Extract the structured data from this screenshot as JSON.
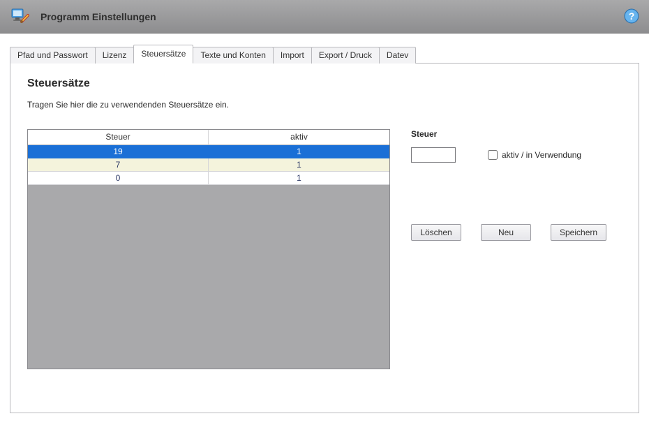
{
  "banner": {
    "title": "Programm Einstellungen"
  },
  "tabs": [
    {
      "label": "Pfad und Passwort",
      "active": false
    },
    {
      "label": "Lizenz",
      "active": false
    },
    {
      "label": "Steuersätze",
      "active": true
    },
    {
      "label": "Texte und Konten",
      "active": false
    },
    {
      "label": "Import",
      "active": false
    },
    {
      "label": "Export / Druck",
      "active": false
    },
    {
      "label": "Datev",
      "active": false
    }
  ],
  "panel": {
    "heading": "Steuersätze",
    "description": "Tragen Sie hier die zu verwendenden Steuersätze ein."
  },
  "grid": {
    "columns": [
      "Steuer",
      "aktiv"
    ],
    "rows": [
      {
        "steuer": "19",
        "aktiv": "1",
        "style": "sel"
      },
      {
        "steuer": "7",
        "aktiv": "1",
        "style": "alt"
      },
      {
        "steuer": "0",
        "aktiv": "1",
        "style": "norm"
      }
    ]
  },
  "side": {
    "label": "Steuer",
    "input_value": "",
    "checkbox_label": "aktiv / in Verwendung",
    "checkbox_checked": false
  },
  "buttons": {
    "delete": "Löschen",
    "new": "Neu",
    "save": "Speichern"
  }
}
